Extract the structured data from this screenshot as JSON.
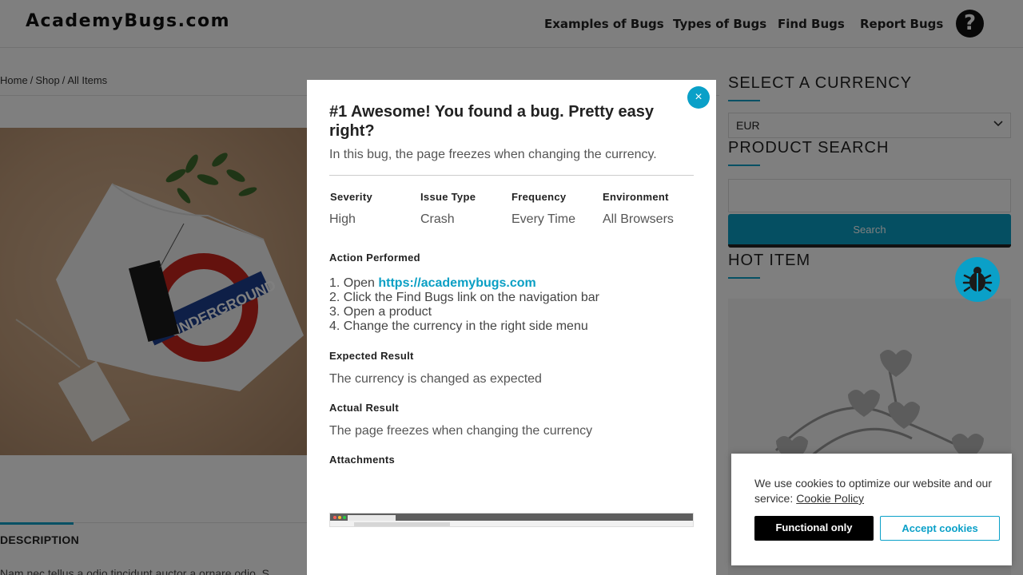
{
  "header": {
    "logo": "AcademyBugs.com",
    "nav": [
      "Examples of Bugs",
      "Types of Bugs",
      "Find Bugs",
      "Report Bugs"
    ],
    "help_icon": "question-circle-icon"
  },
  "breadcrumb": [
    "Home",
    "Shop",
    "All Items"
  ],
  "product": {
    "image_icon": "tshirt-product-image",
    "description_tab": "DESCRIPTION",
    "description_text": "Nam nec tellus a odio tincidunt auctor a ornare odio. S"
  },
  "sidebar": {
    "currency_heading": "SELECT A CURRENCY",
    "currency_value": "EUR",
    "search_heading": "PRODUCT SEARCH",
    "search_button": "Search",
    "hot_heading": "HOT ITEM",
    "bug_icon": "bug-icon"
  },
  "modal": {
    "title": "#1 Awesome! You found a bug. Pretty easy right?",
    "subtitle": "In this bug, the page freezes when changing the currency.",
    "close_label": "×",
    "meta": [
      {
        "label": "Severity",
        "value": "High"
      },
      {
        "label": "Issue Type",
        "value": "Crash"
      },
      {
        "label": "Frequency",
        "value": "Every Time"
      },
      {
        "label": "Environment",
        "value": "All Browsers"
      }
    ],
    "action_label": "Action Performed",
    "steps": {
      "s1_prefix": "1. Open ",
      "s1_link": "https://academybugs.com",
      "s2": "2. Click the Find Bugs link on the navigation bar",
      "s3": "3. Open a product",
      "s4": "4. Change the currency in the right side menu"
    },
    "expected_label": "Expected Result",
    "expected_value": "The currency is changed as expected",
    "actual_label": "Actual Result",
    "actual_value": "The page freezes when changing the currency",
    "attachments_label": "Attachments"
  },
  "cookie": {
    "text": "We use cookies to optimize our website and our service:",
    "policy_link": "Cookie Policy",
    "functional_button": "Functional only",
    "accept_button": "Accept cookies"
  },
  "colors": {
    "accent": "#0aa0c8",
    "overlay": "rgba(0,0,0,0.5)"
  }
}
